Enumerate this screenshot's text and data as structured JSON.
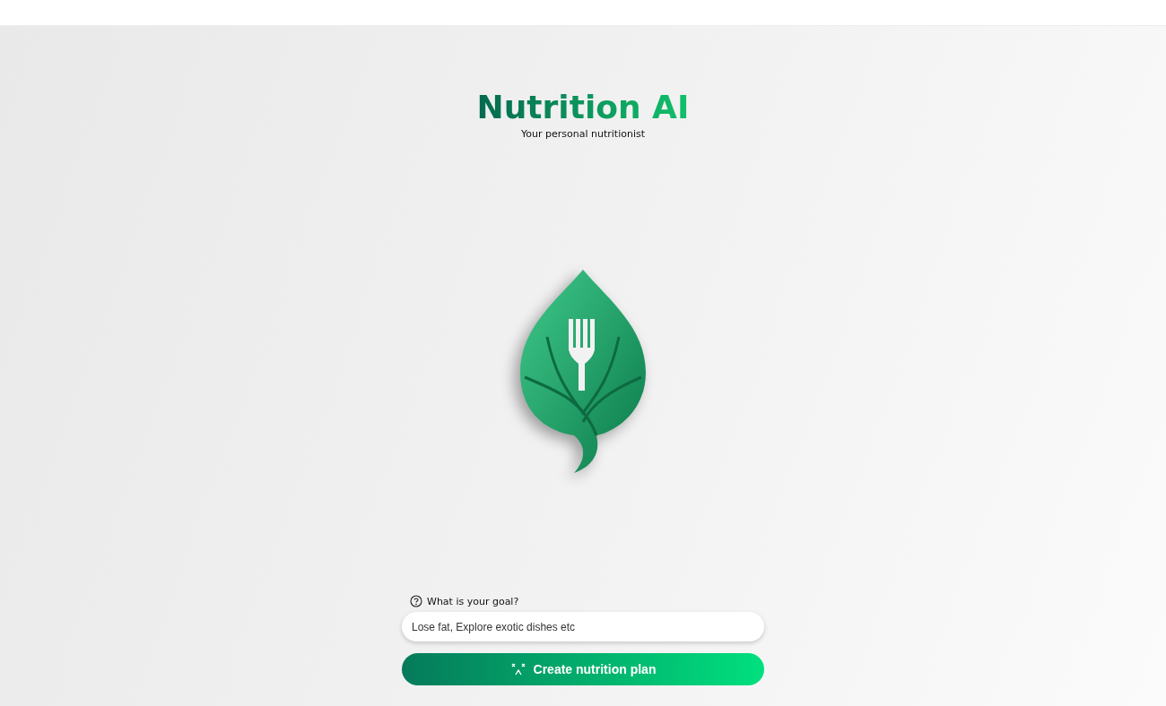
{
  "header": {
    "title": "Nutrition AI",
    "subtitle": "Your personal nutritionist"
  },
  "goal": {
    "label": "What is your goal?",
    "placeholder": "Lose fat, Explore exotic dishes etc"
  },
  "submit": {
    "label": "Create nutrition plan"
  }
}
